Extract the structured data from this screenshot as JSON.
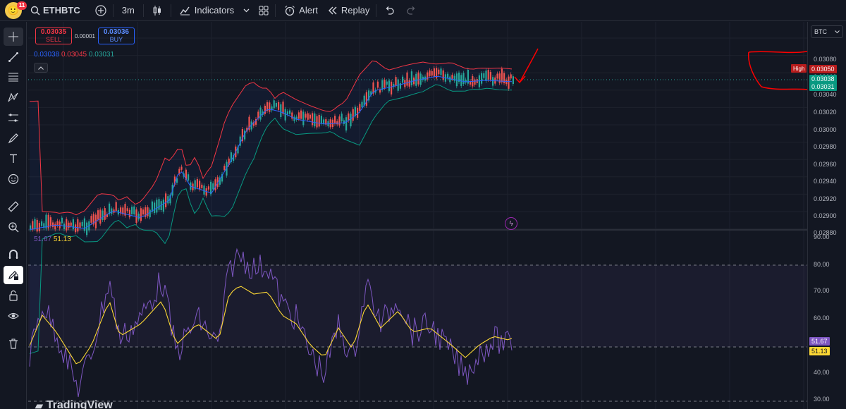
{
  "topbar": {
    "notification_count": "11",
    "symbol": "ETHBTC",
    "interval": "3m",
    "indicators_label": "Indicators",
    "alert_label": "Alert",
    "replay_label": "Replay"
  },
  "trade": {
    "sell_price": "0.03035",
    "sell_label": "SELL",
    "spread": "0.00001",
    "buy_price": "0.03036",
    "buy_label": "BUY"
  },
  "bollinger": {
    "basis": "0.03038",
    "upper": "0.03045",
    "lower": "0.03031"
  },
  "rsi": {
    "value": "51.67",
    "ma": "51.13"
  },
  "price_axis": {
    "currency": "BTC",
    "ticks": [
      "0.03080",
      "0.03060",
      "0.03040",
      "0.03020",
      "0.03000",
      "0.02980",
      "0.02960",
      "0.02940",
      "0.02920",
      "0.02900",
      "0.02880"
    ],
    "high_label": "High",
    "high_value": "0.03050",
    "tag_1": "0.03038",
    "tag_2": "0.03031"
  },
  "rsi_axis": {
    "ticks": [
      "90.00",
      "80.00",
      "70.00",
      "60.00",
      "40.00",
      "30.00"
    ],
    "tag_rsi": "51.67",
    "tag_ma": "51.13"
  },
  "watermark": "TradingView",
  "colors": {
    "background": "#131722",
    "up_candle": "#26a69a",
    "down_candle": "#ef5350",
    "bb_basis": "#2962ff",
    "bb_upper": "#f23645",
    "bb_lower": "#089981",
    "rsi_line": "#7e57c2",
    "rsi_ma": "#fdd835",
    "annotation": "#ff0000"
  },
  "icons": {
    "sidebar": [
      "crosshair-icon",
      "trend-line-icon",
      "fib-icon",
      "pattern-icon",
      "forecast-icon",
      "brush-icon",
      "text-icon",
      "emoji-icon",
      "ruler-icon",
      "zoom-icon",
      "magnet-icon",
      "lock-drawing-icon",
      "lock-icon",
      "eye-icon",
      "trash-icon"
    ]
  }
}
